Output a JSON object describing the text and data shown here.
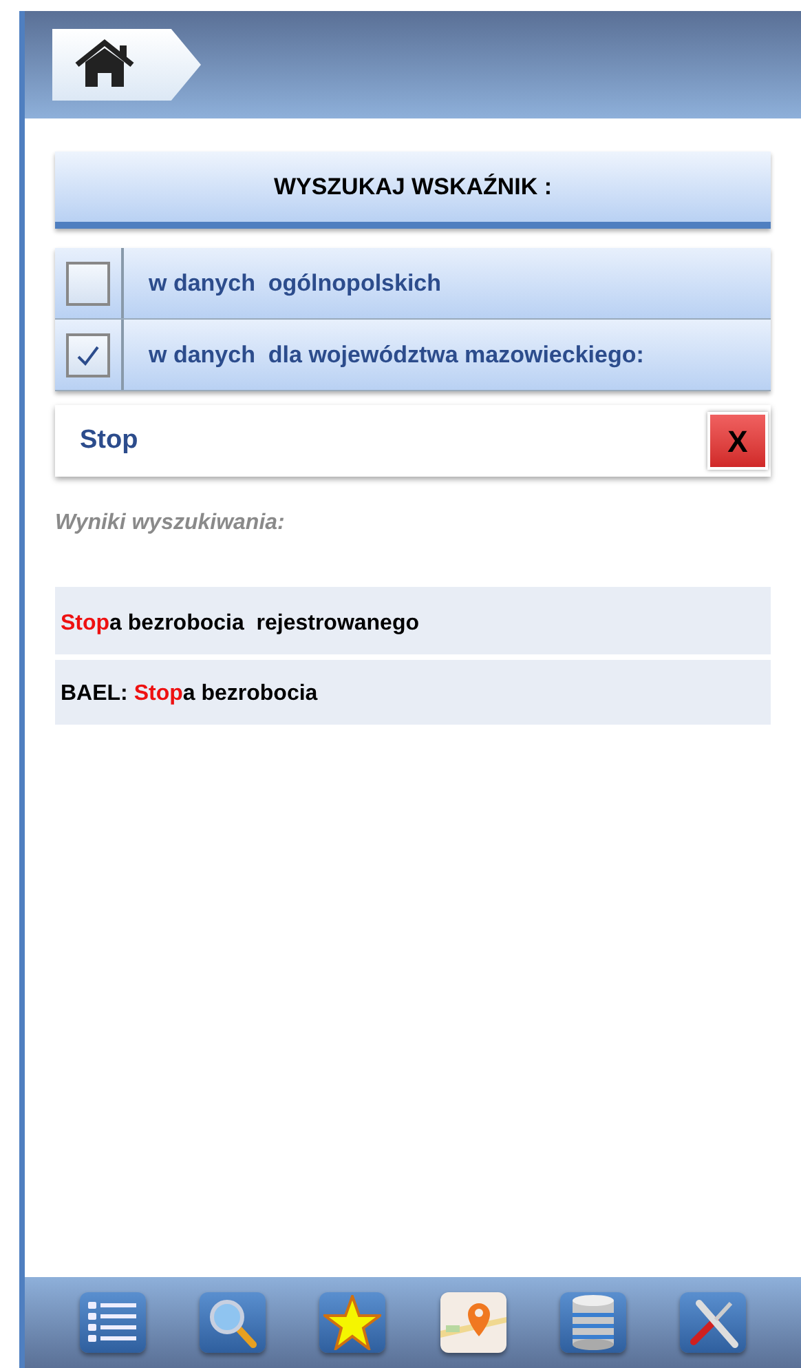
{
  "search_heading": "WYSZUKAJ WSKAŹNIK :",
  "scopes": [
    {
      "label": "w danych  ogólnopolskich",
      "checked": false
    },
    {
      "label": "w danych  dla województwa mazowieckiego:",
      "checked": true
    }
  ],
  "search": {
    "value": "Stop",
    "clear_label": "X"
  },
  "results_heading": "Wyniki wyszukiwania:",
  "results": [
    {
      "parts": [
        {
          "text": "Stop",
          "highlight": true
        },
        {
          "text": "a bezrobocia  rejestrowanego",
          "highlight": false
        }
      ]
    },
    {
      "parts": [
        {
          "text": "BAEL: ",
          "highlight": false
        },
        {
          "text": "Stop",
          "highlight": true
        },
        {
          "text": "a bezrobocia",
          "highlight": false
        }
      ]
    }
  ],
  "toolbar": [
    {
      "kind": "list"
    },
    {
      "kind": "search"
    },
    {
      "kind": "star"
    },
    {
      "kind": "map"
    },
    {
      "kind": "database"
    },
    {
      "kind": "tools"
    }
  ]
}
